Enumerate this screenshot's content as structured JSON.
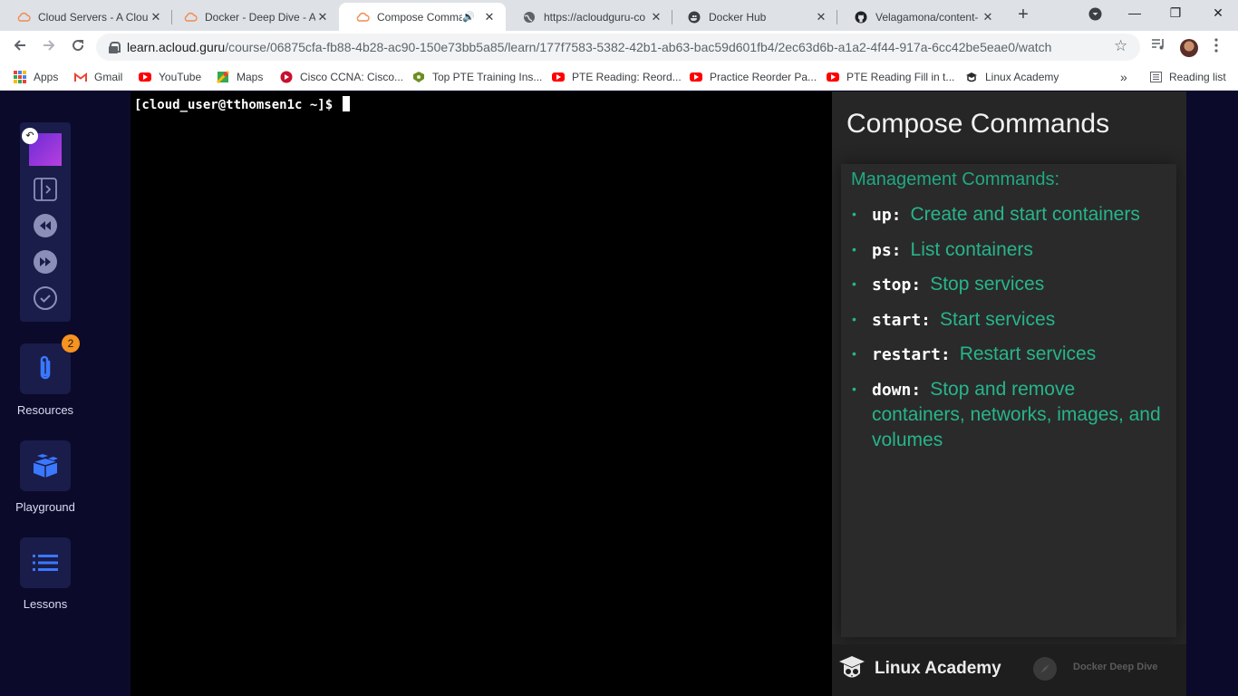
{
  "browser": {
    "tabs": [
      {
        "title": "Cloud Servers - A Clou",
        "favicon": "cloud-icon",
        "active": false
      },
      {
        "title": "Docker - Deep Dive - A",
        "favicon": "cloud-icon",
        "active": false
      },
      {
        "title": "Compose Comma",
        "favicon": "cloud-icon",
        "active": true,
        "audio": true
      },
      {
        "title": "https://acloudguru-co",
        "favicon": "globe-icon",
        "active": false
      },
      {
        "title": "Docker Hub",
        "favicon": "docker-icon",
        "active": false
      },
      {
        "title": "Velagamona/content-",
        "favicon": "github-icon",
        "active": false
      }
    ],
    "tab_close": "✕",
    "new_tab": "+",
    "window": {
      "minimize": "—",
      "maximize": "❐",
      "close": "✕"
    },
    "url_host": "learn.acloud.guru",
    "url_path": "/course/06875cfa-fb88-4b28-ac90-150e73bb5a85/learn/177f7583-5382-42b1-ab63-bac59d601fb4/2ec63d6b-a1a2-4f44-917a-6cc42be5eae0/watch",
    "bookmarks": [
      {
        "label": "Apps",
        "icon": "apps-grid-icon"
      },
      {
        "label": "Gmail",
        "icon": "gmail-icon"
      },
      {
        "label": "YouTube",
        "icon": "youtube-icon"
      },
      {
        "label": "Maps",
        "icon": "maps-icon"
      },
      {
        "label": "Cisco CCNA: Cisco...",
        "icon": "cisco-icon"
      },
      {
        "label": "Top PTE Training Ins...",
        "icon": "pte-icon"
      },
      {
        "label": "PTE Reading: Reord...",
        "icon": "youtube-icon"
      },
      {
        "label": "Practice Reorder Pa...",
        "icon": "youtube-icon"
      },
      {
        "label": "PTE Reading Fill in t...",
        "icon": "youtube-icon"
      },
      {
        "label": "Linux Academy",
        "icon": "linux-academy-icon"
      }
    ],
    "bookmarks_overflow": "»",
    "reading_list": "Reading list"
  },
  "sidebar": {
    "resources": {
      "label": "Resources",
      "badge": "2"
    },
    "playground": {
      "label": "Playground"
    },
    "lessons": {
      "label": "Lessons"
    }
  },
  "terminal": {
    "prompt": "[cloud_user@tthomsen1c ~]$ "
  },
  "slide": {
    "title": "Compose Commands",
    "subtitle": "Management Commands:",
    "commands": [
      {
        "keyword": "up:",
        "desc": "Create and start containers"
      },
      {
        "keyword": "ps:",
        "desc": "List containers"
      },
      {
        "keyword": "stop:",
        "desc": "Stop services"
      },
      {
        "keyword": "start:",
        "desc": "Start services"
      },
      {
        "keyword": "restart:",
        "desc": "Restart services"
      },
      {
        "keyword": "down:",
        "desc": "Stop and remove containers, networks, images, and volumes"
      }
    ],
    "footer_brand": "Linux Academy",
    "footer_course": "Docker Deep Dive"
  },
  "colors": {
    "slide_accent": "#27b58b",
    "page_bg": "#0b0a2a",
    "badge": "#f7931e",
    "resources_icon": "#3a78ff"
  }
}
